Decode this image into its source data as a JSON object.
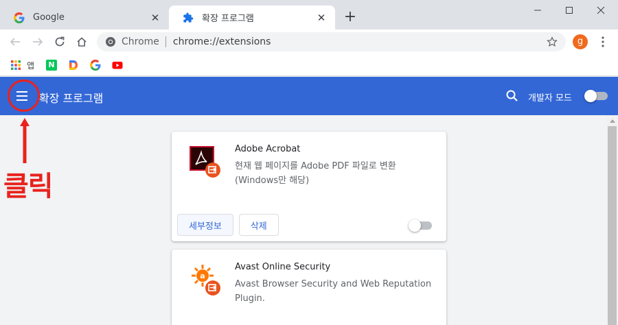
{
  "tabs": [
    {
      "title": "Google",
      "icon": "google-g-icon",
      "active": false
    },
    {
      "title": "확장 프로그램",
      "icon": "puzzle-icon",
      "active": true
    }
  ],
  "new_tab_label": "+",
  "toolbar": {
    "site_chip": "Chrome",
    "url": "chrome://extensions",
    "avatar_letter": "g"
  },
  "bookmarks": [
    {
      "label": "앱",
      "icon": "apps-grid-icon"
    },
    {
      "label": "",
      "icon": "naver-n-icon"
    },
    {
      "label": "",
      "icon": "daum-d-icon"
    },
    {
      "label": "",
      "icon": "google-g-icon"
    },
    {
      "label": "",
      "icon": "youtube-icon"
    }
  ],
  "header": {
    "title": "확장 프로그램",
    "dev_mode_label": "개발자 모드",
    "dev_mode_on": false
  },
  "extensions": [
    {
      "name": "Adobe Acrobat",
      "description": "현재 웹 페이지를 Adobe PDF 파일로 변환 (Windows만 해당)",
      "details_label": "세부정보",
      "remove_label": "삭제",
      "enabled": false
    },
    {
      "name": "Avast Online Security",
      "description": "Avast Browser Security and Web Reputation Plugin."
    }
  ],
  "annotation": {
    "label": "클릭"
  },
  "colors": {
    "header_blue": "#3367d6",
    "annotation_red": "#e8231e",
    "avatar_orange": "#f06a1d"
  }
}
